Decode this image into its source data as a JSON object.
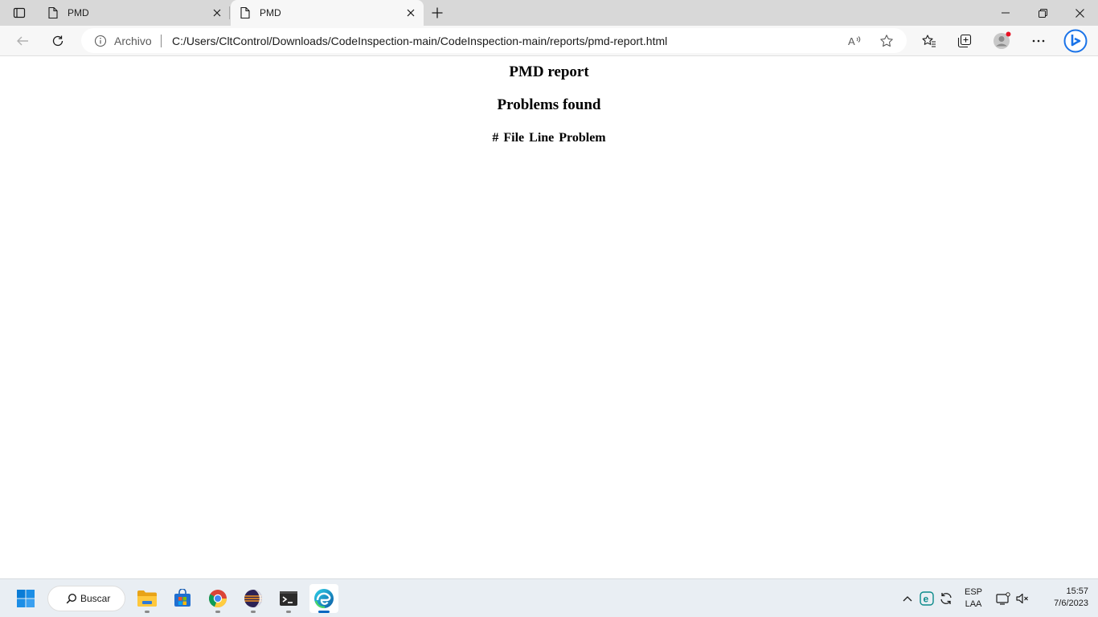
{
  "tabs": [
    {
      "title": "PMD"
    },
    {
      "title": "PMD"
    }
  ],
  "addressbar": {
    "site_label": "Archivo",
    "url": "C:/Users/CltControl/Downloads/CodeInspection-main/CodeInspection-main/reports/pmd-report.html"
  },
  "page": {
    "title": "PMD report",
    "subtitle": "Problems found",
    "table_headers": [
      "#",
      "File",
      "Line",
      "Problem"
    ]
  },
  "taskbar": {
    "search_label": "Buscar",
    "language": "ESP",
    "layout": "LAA",
    "time": "15:57",
    "date": "7/6/2023"
  },
  "colors": {
    "tabstrip": "#d8d8d8",
    "toolbar": "#f7f7f7",
    "profile_badge": "#e81123",
    "edge_accent": "#0067c0",
    "copilot": "#1a73e8"
  },
  "icons": [
    "tab-actions-icon",
    "page-icon",
    "close-icon",
    "plus-icon",
    "minimize-icon",
    "restore-icon",
    "back-icon",
    "refresh-icon",
    "info-icon",
    "read-aloud-icon",
    "star-icon",
    "favorites-icon",
    "collections-icon",
    "profile-icon",
    "more-icon",
    "copilot-icon",
    "windows-icon",
    "search-icon",
    "file-explorer-icon",
    "store-icon",
    "chrome-icon",
    "eclipse-icon",
    "terminal-icon",
    "edge-icon",
    "chevron-up-icon",
    "network-icon",
    "volume-muted-icon"
  ]
}
